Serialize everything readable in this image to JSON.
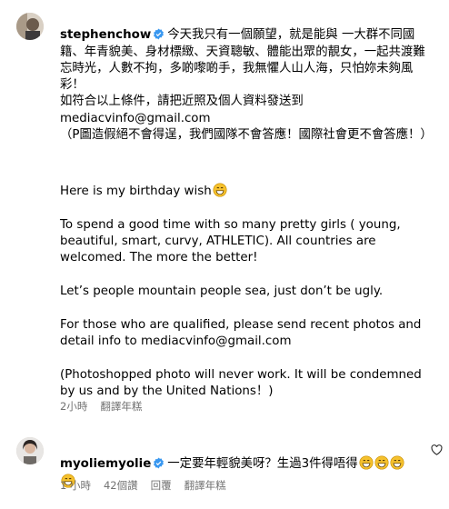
{
  "comments": [
    {
      "username": "stephenchow",
      "text_zh_1": "今天我只有一個願望，就是能與 一大群不同國籍、年青貌美、身材標緻、天資聰敏、體能出眾的靚女，一起共渡難忘時光，人數不拘，多啲嚟啲手，我無懼人山人海，只怕妳未夠風彩！",
      "text_zh_2": "如符合以上條件，請把近照及個人資料發送到",
      "text_zh_3": "mediacvinfo@gmail.com",
      "text_zh_4": "（P圖造假絕不會得逞，我們國隊不會答應！國際社會更不會答應！）",
      "text_en_1": "Here is my birthday wish",
      "text_en_2": "To spend a good time with so many pretty girls ( young, beautiful, smart, curvy, ATHLETIC). All countries are welcomed. The more the better!",
      "text_en_3": "Let’s people mountain people sea, just don’t be ugly.",
      "text_en_4": "For those who are qualified, please send recent photos and detail info to mediacvinfo@gmail.com",
      "text_en_5": "(Photoshopped photo will never work. It will be condemned by us and by the United Nations！)",
      "time": "2小時",
      "translate": "翻譯年糕"
    },
    {
      "username": "myoliemyolie",
      "text": "一定要年輕貌美呀？生過3件得唔得",
      "time": "1 小時",
      "likes": "42個讚",
      "reply": "回覆",
      "translate": "翻譯年糕"
    }
  ],
  "icons": {
    "verified": "verified-badge-icon",
    "heart": "heart-icon",
    "emoji": "grinning-sweat-emoji"
  },
  "colors": {
    "verified": "#3897f0",
    "meta": "#737373",
    "emoji": "#f5c12e"
  }
}
